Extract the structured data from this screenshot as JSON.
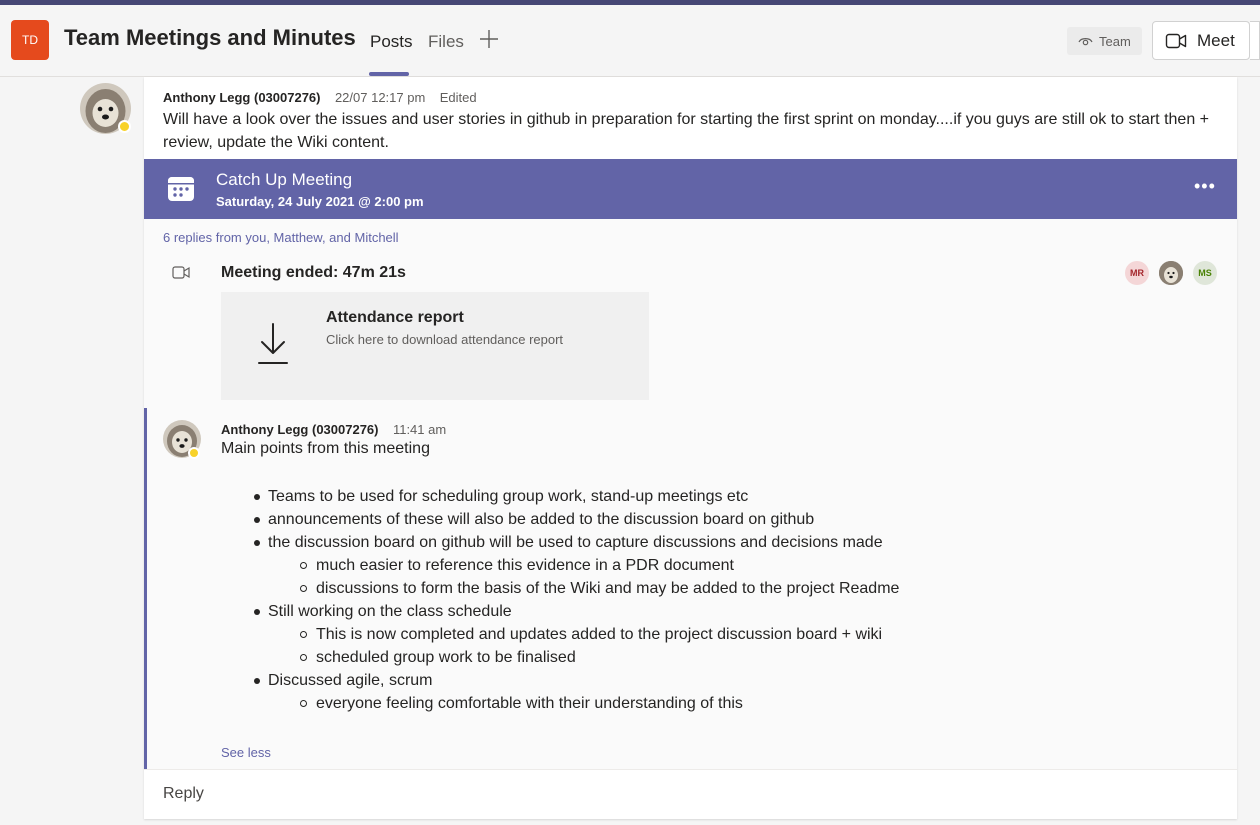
{
  "header": {
    "team_initials": "TD",
    "channel_title": "Team Meetings and Minutes",
    "tabs": [
      {
        "label": "Posts",
        "active": true
      },
      {
        "label": "Files",
        "active": false
      }
    ],
    "add_tab_icon": "plus-icon",
    "team_label": "Team",
    "meet_label": "Meet"
  },
  "post": {
    "author": "Anthony Legg (03007276)",
    "time": "22/07 12:17 pm",
    "edited": "Edited",
    "body": "Will have a look over the issues and user stories in github in preparation for starting the first sprint on monday....if you guys are still ok to start then + review, update the Wiki content."
  },
  "meeting": {
    "title": "Catch Up Meeting",
    "date": "Saturday, 24 July 2021 @ 2:00 pm",
    "more_label": "•••"
  },
  "replies_summary": "6 replies from you, Matthew, and Mitchell",
  "meeting_ended": "Meeting ended: 47m 21s",
  "participants": [
    {
      "initials": "MR",
      "bg": "#f4d6d7",
      "fg": "#a4262c"
    },
    {
      "initials": "",
      "photo": true
    },
    {
      "initials": "MS",
      "bg": "#dfe6d9",
      "fg": "#498205"
    }
  ],
  "attendance": {
    "title": "Attendance report",
    "subtitle": "Click here to download attendance report"
  },
  "reply": {
    "author": "Anthony Legg (03007276)",
    "time": "11:41 am",
    "intro": "Main points from this meeting",
    "bullets": [
      {
        "level": 1,
        "text": "Teams to be used for scheduling group work, stand-up meetings etc"
      },
      {
        "level": 1,
        "text": "announcements of these will also be added to the discussion board on github"
      },
      {
        "level": 1,
        "text": "the discussion board on github will be used to capture discussions and decisions made"
      },
      {
        "level": 2,
        "text": "much easier to reference this evidence in a PDR document"
      },
      {
        "level": 2,
        "text": "discussions to form the basis of the Wiki and may be added to the project Readme"
      },
      {
        "level": 1,
        "text": "Still working on the class schedule"
      },
      {
        "level": 2,
        "text": "This is now completed and updates added to the project discussion board + wiki"
      },
      {
        "level": 2,
        "text": "scheduled group work to be finalised"
      },
      {
        "level": 1,
        "text": "Discussed agile, scrum"
      },
      {
        "level": 2,
        "text": "everyone feeling comfortable with their understanding of this"
      }
    ],
    "see_less": "See less"
  },
  "reply_box_label": "Reply",
  "colors": {
    "accent": "#6264a7",
    "team_avatar": "#e54a1d",
    "status_away": "#f8d22a",
    "header_strip": "#464775"
  }
}
